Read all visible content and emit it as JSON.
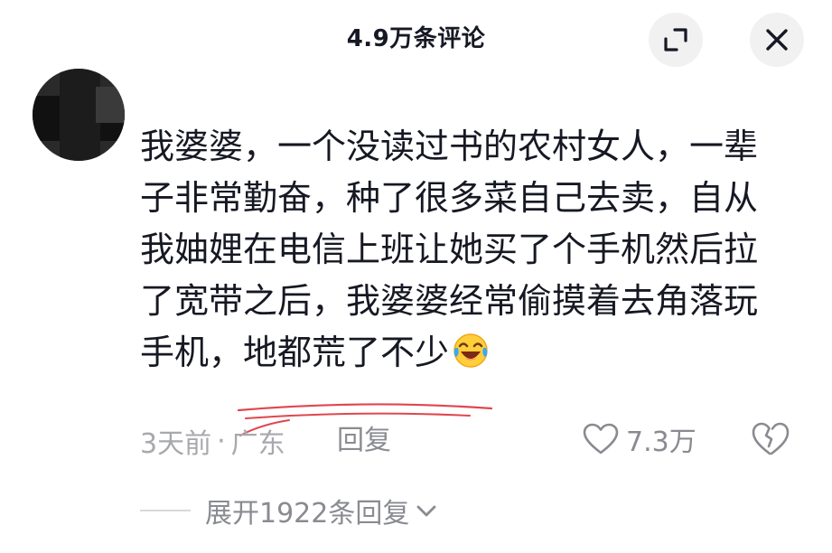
{
  "header": {
    "title": "4.9万条评论"
  },
  "comment": {
    "lines": [
      "我婆婆，一个没读过书的农村女人，一辈",
      "子非常勤奋，种了很多菜自己去卖，自从",
      "我妯娌在电信上班让她买了个手机然后拉",
      "了宽带之后，我婆婆经常偷摸着去角落玩"
    ],
    "last_line_prefix": "手机，",
    "last_line_highlight": "地都荒了不少",
    "emoji": "laughing-crying-emoji",
    "time": "3天前",
    "dot": "·",
    "location": "广东",
    "reply_label": "回复",
    "likes": "7.3万"
  },
  "replies": {
    "expand_label": "展开1922条回复"
  },
  "colors": {
    "text": "#161823",
    "muted": "#a8a9ad",
    "underline": "#e0464f",
    "button_bg": "#f1f1f2"
  }
}
